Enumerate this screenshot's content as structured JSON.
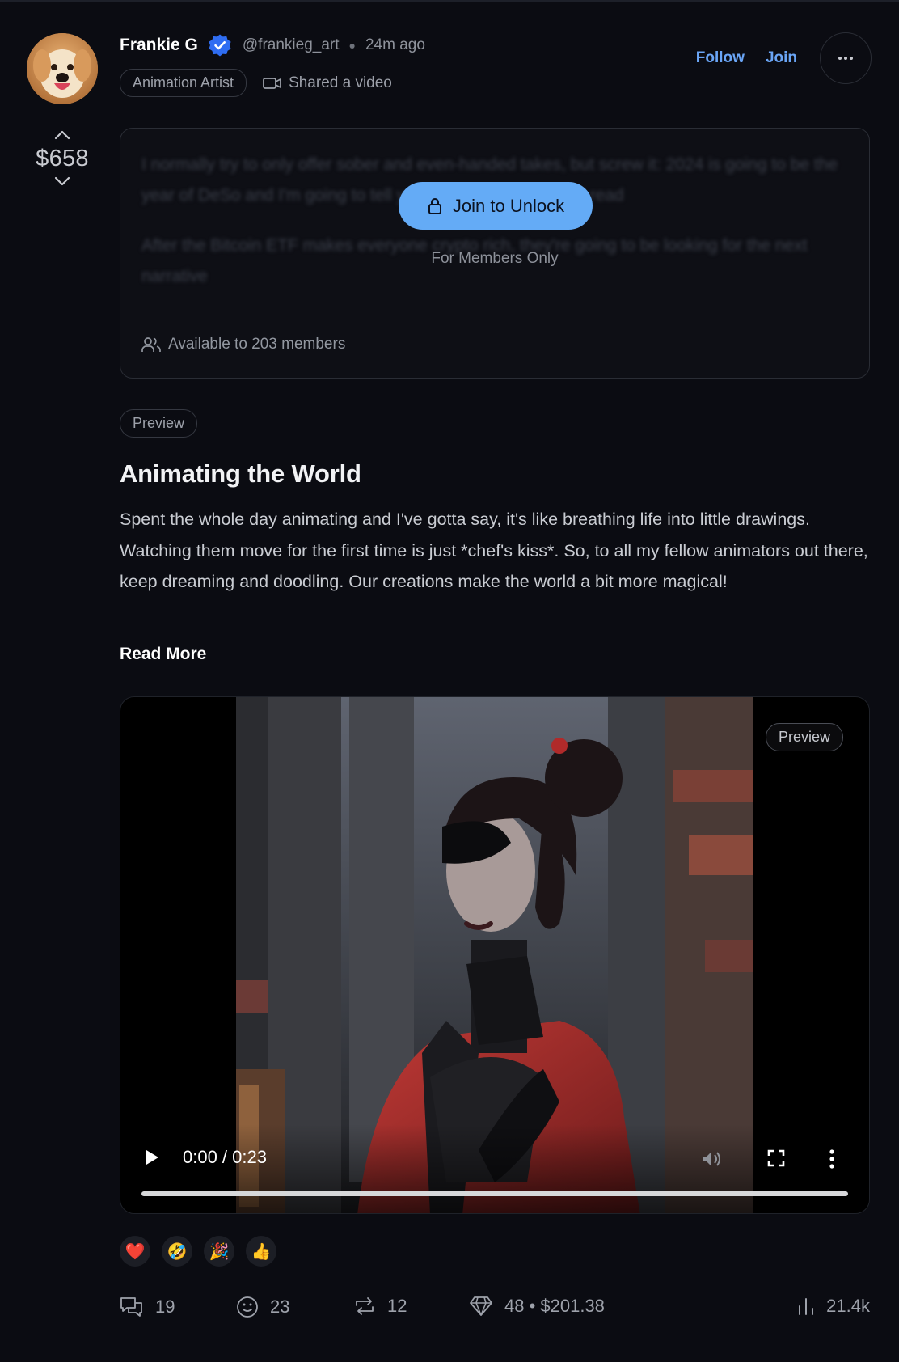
{
  "author": {
    "name": "Frankie G",
    "handle": "@frankieg_art",
    "time_ago": "24m ago",
    "role_tag": "Animation Artist",
    "activity": "Shared a video"
  },
  "actions": {
    "follow_label": "Follow",
    "join_label": "Join"
  },
  "vote": {
    "amount": "$658"
  },
  "locked": {
    "blurred_lines": [
      "I normally try to only offer sober and even-handed takes, but screw it: 2024 is going to be the year of DeSo and I'm going to tell you why, and... Unlock to read",
      "After the Bitcoin ETF makes everyone crypto rich, they're going to be looking for the next narrative"
    ],
    "unlock_label": "Join to Unlock",
    "members_only": "For Members Only",
    "available": "Available to 203 members"
  },
  "post": {
    "preview_tag": "Preview",
    "title": "Animating the World",
    "body": "Spent the whole day animating and I've gotta say, it's like breathing life into little drawings. Watching them move for the first time is just *chef's kiss*. So, to all my fellow animators out there, keep dreaming and doodling. Our creations make the world a bit more magical!",
    "read_more": "Read More"
  },
  "video": {
    "preview_tag": "Preview",
    "time": "0:00 / 0:23",
    "progress": 0
  },
  "reactions": [
    "❤️",
    "🤣",
    "🎉",
    "👍"
  ],
  "stats": {
    "comments": "19",
    "reactions": "23",
    "reposts": "12",
    "diamonds": "48 • $201.38",
    "views": "21.4k"
  },
  "colors": {
    "accent": "#6aa5f5",
    "unlock_button": "#64abf6",
    "verified": "#2f6df2",
    "background": "#0b0c12"
  }
}
